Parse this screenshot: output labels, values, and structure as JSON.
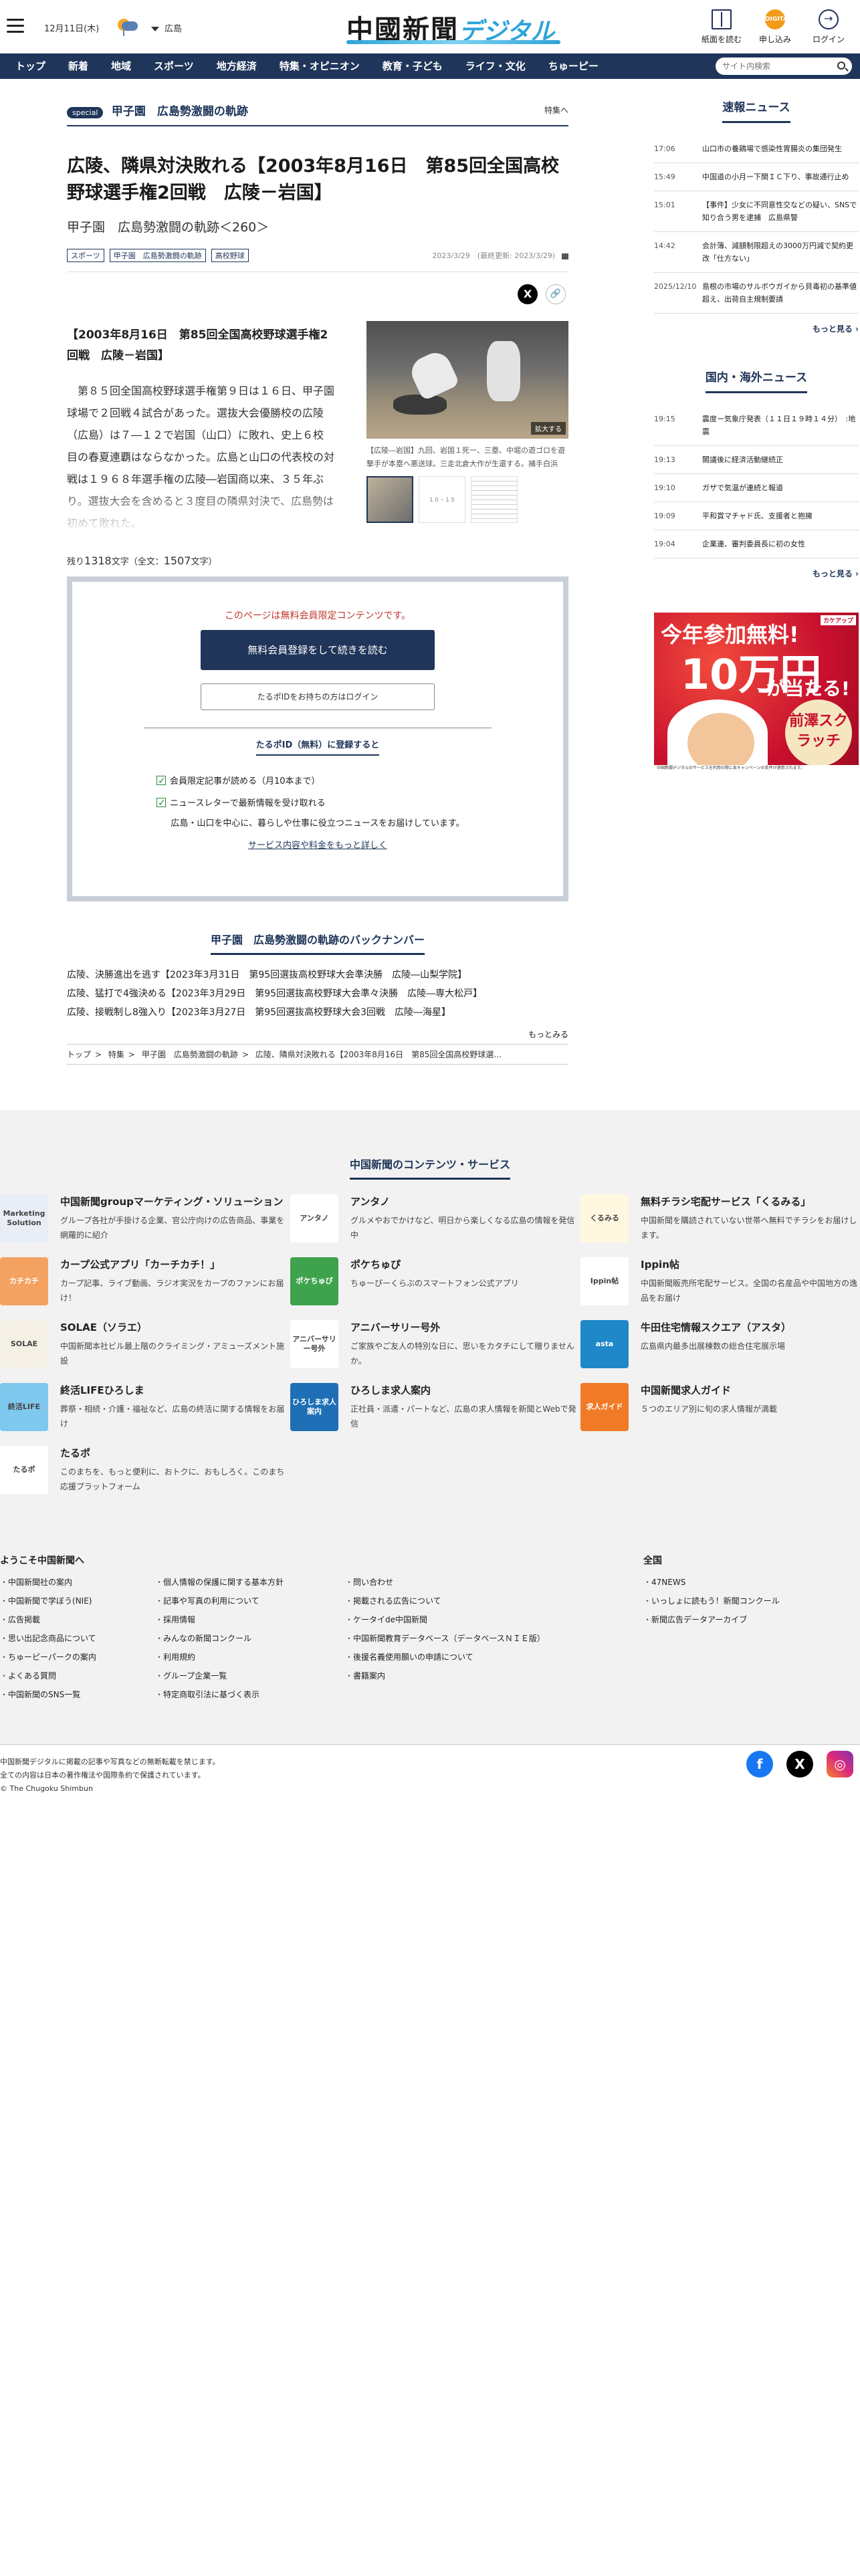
{
  "header": {
    "date": "12月11日(木)",
    "region": "広島",
    "logo_main": "中國新聞",
    "logo_sub": "デジタル",
    "btn_paper": "紙面を読む",
    "btn_subscribe": "申し込み",
    "btn_subscribe_icon_text": "DIGITAL",
    "btn_login": "ログイン"
  },
  "nav": {
    "items": [
      "トップ",
      "新着",
      "地域",
      "スポーツ",
      "地方経済",
      "特集・オピニオン",
      "教育・子ども",
      "ライフ・文化",
      "ちゅーピー"
    ],
    "search_placeholder": "サイト内検索"
  },
  "article": {
    "special_badge": "special",
    "series_title": "甲子園　広島勢激闘の軌跡",
    "series_link": "特集へ",
    "title": "広陵、隣県対決敗れる【2003年8月16日　第85回全国高校野球選手権2回戦　広陵－岩国】",
    "subtitle": "甲子園　広島勢激闘の軌跡＜260＞",
    "tags": [
      "スポーツ",
      "甲子園　広島勢激闘の軌跡",
      "高校野球"
    ],
    "dates": "2023/3/29　(最終更新: 2023/3/29)",
    "share_x": "X",
    "share_link": "🔗",
    "lead": "【2003年8月16日　第85回全国高校野球選手権2回戦　広陵－岩国】",
    "body": "第８５回全国高校野球選手権第９日は１６日、甲子園球場で２回戦４試合があった。選抜大会優勝校の広陵（広島）は７―１２で岩国（山口）に敗れ、史上６校目の春夏連覇はならなかった。広島と山口の代表校の対戦は１９６８年選手権の広陵―岩国商以来、３５年ぶり。選抜大会を含めると３度目の隣県対決で、広島勢は初めて敗れた。",
    "photo_zoom": "拡大する",
    "photo_caption": "【広陵―岩国】九回、岩国１死一、三塁、中堀の遊ゴロを遊撃手が本塁へ悪送球。三走北倉大作が生還する。捕手白浜",
    "thumb_label": "１０・１５",
    "remaining_label": "残り",
    "remaining_count": "1318",
    "remaining_unit": "文字（全文：",
    "total_count": "1507",
    "total_unit": "文字）"
  },
  "paywall": {
    "message": "このページは無料会員限定コンテンツです。",
    "register_button": "無料会員登録をして続きを読む",
    "login_button": "たるポIDをお持ちの方はログイン",
    "register_head": "たるポID（無料）に登録すると",
    "benefits": [
      "会員限定記事が読める（月10本まで）",
      "ニュースレターで最新情報を受け取れる"
    ],
    "description": "広島・山口を中心に、暮らしや仕事に役立つニュースをお届けしています。",
    "more_link": "サービス内容や料金をもっと詳しく"
  },
  "backnumber": {
    "title": "甲子園　広島勢激闘の軌跡のバックナンバー",
    "items": [
      "広陵、決勝進出を逃す【2023年3月31日　第95回選抜高校野球大会準決勝　広陵―山梨学院】",
      "広陵、猛打で4強決める【2023年3月29日　第95回選抜高校野球大会準々決勝　広陵―専大松戸】",
      "広陵、接戦制し8強入り【2023年3月27日　第95回選抜高校野球大会3回戦　広陵―海星】"
    ],
    "more": "もっとみる"
  },
  "breadcrumb": [
    "トップ",
    "特集",
    "甲子園　広島勢激闘の軌跡",
    "広陵、隣県対決敗れる【2003年8月16日　第85回全国高校野球選…"
  ],
  "sidebar": {
    "breaking_title": "速報ニュース",
    "breaking": [
      {
        "time": "17:06",
        "headline": "山口市の養鶏場で感染性胃腸炎の集団発生"
      },
      {
        "time": "15:49",
        "headline": "中国道の小月ー下関ＩＣ下り、事故通行止め"
      },
      {
        "time": "15:01",
        "headline": "【事件】少女に不同意性交などの疑い、SNSで知り合う男を逮捕　広島県警"
      },
      {
        "time": "14:42",
        "headline": "会計簿、減額制限超えの3000万円減で契約更改「仕方ない」"
      },
      {
        "time": "2025/12/10",
        "headline": "島根の市場のサルボウガイから貝毒初の基準値超え、出荷自主規制要請"
      }
    ],
    "more1": "もっと見る",
    "world_title": "国内・海外ニュース",
    "world": [
      {
        "time": "19:15",
        "headline": "震度ー気象庁発表（１１日１９時１４分）　:地震"
      },
      {
        "time": "19:13",
        "headline": "閣議後に経済活動継続正"
      },
      {
        "time": "19:10",
        "headline": "ガザで気温が連続と報道"
      },
      {
        "time": "19:09",
        "headline": "平和賞マチャド氏、支援者と抱擁"
      },
      {
        "time": "19:04",
        "headline": "企業連、審判委員長に初の女性"
      }
    ],
    "more2": "もっと見る",
    "ad": {
      "line1": "今年参加無料!",
      "line2": "10万円",
      "line3": "が当たる!",
      "line4": "前澤スクラッチ",
      "badge": "カケアップ",
      "fine": "中国新聞デジタルのサービスを利用の際に本キャンペーンの条件が適用されます。"
    }
  },
  "services": {
    "title": "中国新聞のコンテンツ・サービス",
    "items": [
      {
        "icon": "Marketing Solution",
        "name": "中国新聞groupマーケティング・ソリューション",
        "desc": "グループ各社が手掛ける企業、官公庁向けの広告商品、事業を網羅的に紹介"
      },
      {
        "icon": "アンタノ",
        "name": "アンタノ",
        "desc": "グルメやおでかけなど、明日から楽しくなる広島の情報を発信中"
      },
      {
        "icon": "くるみる",
        "name": "無料チラシ宅配サービス「くるみる」",
        "desc": "中国新聞を購読されていない世帯へ無料でチラシをお届けします。"
      },
      {
        "icon": "カチカチ",
        "name": "カープ公式アプリ「カーチカチ！」",
        "desc": "カープ記事、ライブ動画、ラジオ実況をカープのファンにお届け！"
      },
      {
        "icon": "ポケちゅぴ",
        "name": "ポケちゅぴ",
        "desc": "ちゅーぴーくらぶのスマートフォン公式アプリ"
      },
      {
        "icon": "Ippin帖",
        "name": "Ippin帖",
        "desc": "中国新聞販売所宅配サービス。全国の名産品や中国地方の逸品をお届け"
      },
      {
        "icon": "SOLAE",
        "name": "SOLAE（ソラエ）",
        "desc": "中国新聞本社ビル最上階のクライミング・アミューズメント施設"
      },
      {
        "icon": "アニバーサリー号外",
        "name": "アニバーサリー号外",
        "desc": "ご家族やご友人の特別な日に、思いをカタチにして贈りませんか。"
      },
      {
        "icon": "asta",
        "name": "牛田住宅情報スクエア（アスタ）",
        "desc": "広島県内最多出展棟数の総合住宅展示場"
      },
      {
        "icon": "終活LIFE",
        "name": "終活LIFEひろしま",
        "desc": "葬祭・相続・介護・福祉など、広島の終活に関する情報をお届け"
      },
      {
        "icon": "ひろしま求人案内",
        "name": "ひろしま求人案内",
        "desc": "正社員・派遣・パートなど、広島の求人情報を新聞とWebで発信"
      },
      {
        "icon": "求人ガイド",
        "name": "中国新聞求人ガイド",
        "desc": "５つのエリア別に旬の求人情報が満載"
      },
      {
        "icon": "たるポ",
        "name": "たるポ",
        "desc": "このまちを、もっと便利に、おトクに、おもしろく。このまち応援プラットフォーム"
      }
    ]
  },
  "footer": {
    "col1_title": "ようこそ中国新聞へ",
    "col1": [
      "中国新聞社の案内",
      "中国新聞で学ぼう(NIE)",
      "広告掲載",
      "思い出記念商品について",
      "ちゅーピーパークの案内",
      "よくある質問",
      "中国新聞のSNS一覧"
    ],
    "col2": [
      "個人情報の保護に関する基本方針",
      "記事や写真の利用について",
      "採用情報",
      "みんなの新聞コンクール",
      "利用規約",
      "グループ企業一覧",
      "特定商取引法に基づく表示"
    ],
    "col3": [
      "問い合わせ",
      "掲載される広告について",
      "ケータイde中国新聞",
      "中国新聞教育データベース（データベースＮＩＥ版）",
      "後援名義使用願いの申請について",
      "書籍案内"
    ],
    "col4_title": "全国",
    "col4": [
      "47NEWS",
      "いっしょに読もう！新聞コンクール",
      "新聞広告データアーカイブ"
    ],
    "copy1": "中国新聞デジタルに掲載の記事や写真などの無断転載を禁じます。",
    "copy2": "全ての内容は日本の著作権法や国際条約で保護されています。",
    "copy3": "© The Chugoku Shimbun",
    "fb": "f",
    "x": "X",
    "ig": "◎"
  }
}
